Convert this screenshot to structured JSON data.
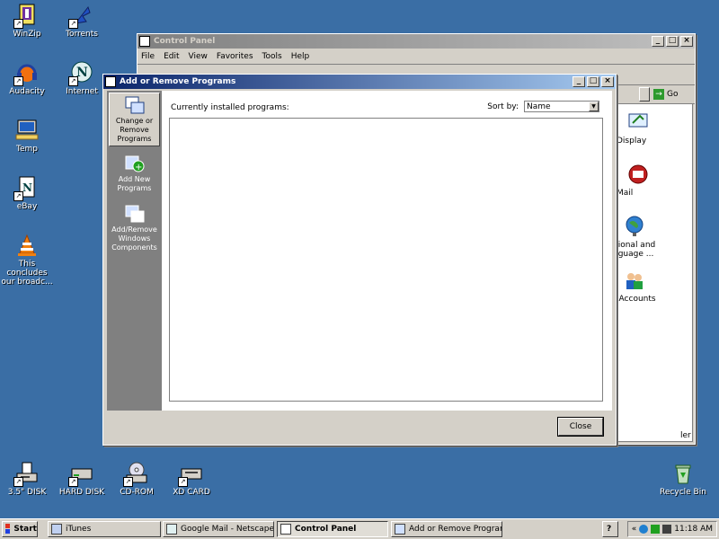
{
  "desktop": {
    "icons": [
      {
        "name": "WinZip"
      },
      {
        "name": "Torrents"
      },
      {
        "name": "Audacity"
      },
      {
        "name": "Internet"
      },
      {
        "name": "Temp"
      },
      {
        "name": "eBay"
      },
      {
        "name": "This concludes our broadc..."
      },
      {
        "name": "3.5\" DISK"
      },
      {
        "name": "HARD DISK"
      },
      {
        "name": "CD-ROM"
      },
      {
        "name": "XD CARD"
      },
      {
        "name": "Recycle Bin"
      }
    ]
  },
  "control_panel": {
    "title": "Control Panel",
    "menu": [
      "File",
      "Edit",
      "View",
      "Favorites",
      "Tools",
      "Help"
    ],
    "go_label": "Go",
    "items": [
      {
        "label": "Display"
      },
      {
        "label": "Mail"
      },
      {
        "label": "gional and nguage ..."
      },
      {
        "label": "r Accounts"
      }
    ],
    "partial_label": "ler"
  },
  "arp": {
    "title": "Add or Remove Programs",
    "sidebar": [
      {
        "label": "Change or Remove Programs"
      },
      {
        "label": "Add New Programs"
      },
      {
        "label": "Add/Remove Windows Components"
      }
    ],
    "installed_label": "Currently installed programs:",
    "sort_label": "Sort by:",
    "sort_value": "Name",
    "close_label": "Close"
  },
  "taskbar": {
    "start_label": "Start",
    "tasks": [
      {
        "label": "iTunes"
      },
      {
        "label": "Google Mail - Netscape N..."
      },
      {
        "label": "Control Panel"
      },
      {
        "label": "Add or Remove Programs"
      }
    ],
    "help_label": "?",
    "chevron": "«",
    "clock": "11:18 AM"
  },
  "colors": {
    "desktop": "#3a6ea5",
    "title_active": "#0a246a",
    "title_inactive": "#808080",
    "face": "#d4d0c8"
  }
}
